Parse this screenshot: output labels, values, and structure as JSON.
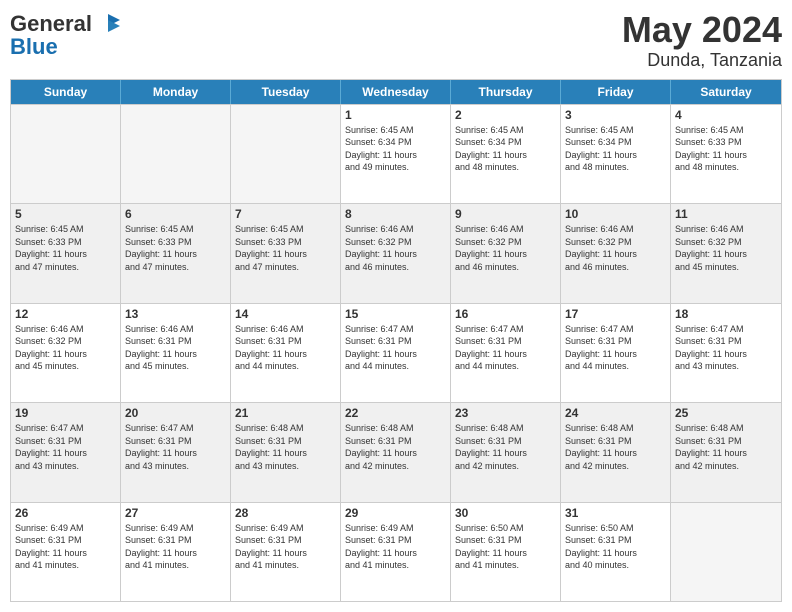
{
  "header": {
    "logo_general": "General",
    "logo_blue": "Blue",
    "month": "May 2024",
    "location": "Dunda, Tanzania"
  },
  "calendar": {
    "days": [
      "Sunday",
      "Monday",
      "Tuesday",
      "Wednesday",
      "Thursday",
      "Friday",
      "Saturday"
    ],
    "rows": [
      [
        {
          "day": "",
          "info": "",
          "empty": true
        },
        {
          "day": "",
          "info": "",
          "empty": true
        },
        {
          "day": "",
          "info": "",
          "empty": true
        },
        {
          "day": "1",
          "info": "Sunrise: 6:45 AM\nSunset: 6:34 PM\nDaylight: 11 hours\nand 49 minutes.",
          "empty": false
        },
        {
          "day": "2",
          "info": "Sunrise: 6:45 AM\nSunset: 6:34 PM\nDaylight: 11 hours\nand 48 minutes.",
          "empty": false
        },
        {
          "day": "3",
          "info": "Sunrise: 6:45 AM\nSunset: 6:34 PM\nDaylight: 11 hours\nand 48 minutes.",
          "empty": false
        },
        {
          "day": "4",
          "info": "Sunrise: 6:45 AM\nSunset: 6:33 PM\nDaylight: 11 hours\nand 48 minutes.",
          "empty": false
        }
      ],
      [
        {
          "day": "5",
          "info": "Sunrise: 6:45 AM\nSunset: 6:33 PM\nDaylight: 11 hours\nand 47 minutes.",
          "empty": false,
          "shaded": true
        },
        {
          "day": "6",
          "info": "Sunrise: 6:45 AM\nSunset: 6:33 PM\nDaylight: 11 hours\nand 47 minutes.",
          "empty": false,
          "shaded": true
        },
        {
          "day": "7",
          "info": "Sunrise: 6:45 AM\nSunset: 6:33 PM\nDaylight: 11 hours\nand 47 minutes.",
          "empty": false,
          "shaded": true
        },
        {
          "day": "8",
          "info": "Sunrise: 6:46 AM\nSunset: 6:32 PM\nDaylight: 11 hours\nand 46 minutes.",
          "empty": false,
          "shaded": true
        },
        {
          "day": "9",
          "info": "Sunrise: 6:46 AM\nSunset: 6:32 PM\nDaylight: 11 hours\nand 46 minutes.",
          "empty": false,
          "shaded": true
        },
        {
          "day": "10",
          "info": "Sunrise: 6:46 AM\nSunset: 6:32 PM\nDaylight: 11 hours\nand 46 minutes.",
          "empty": false,
          "shaded": true
        },
        {
          "day": "11",
          "info": "Sunrise: 6:46 AM\nSunset: 6:32 PM\nDaylight: 11 hours\nand 45 minutes.",
          "empty": false,
          "shaded": true
        }
      ],
      [
        {
          "day": "12",
          "info": "Sunrise: 6:46 AM\nSunset: 6:32 PM\nDaylight: 11 hours\nand 45 minutes.",
          "empty": false
        },
        {
          "day": "13",
          "info": "Sunrise: 6:46 AM\nSunset: 6:31 PM\nDaylight: 11 hours\nand 45 minutes.",
          "empty": false
        },
        {
          "day": "14",
          "info": "Sunrise: 6:46 AM\nSunset: 6:31 PM\nDaylight: 11 hours\nand 44 minutes.",
          "empty": false
        },
        {
          "day": "15",
          "info": "Sunrise: 6:47 AM\nSunset: 6:31 PM\nDaylight: 11 hours\nand 44 minutes.",
          "empty": false
        },
        {
          "day": "16",
          "info": "Sunrise: 6:47 AM\nSunset: 6:31 PM\nDaylight: 11 hours\nand 44 minutes.",
          "empty": false
        },
        {
          "day": "17",
          "info": "Sunrise: 6:47 AM\nSunset: 6:31 PM\nDaylight: 11 hours\nand 44 minutes.",
          "empty": false
        },
        {
          "day": "18",
          "info": "Sunrise: 6:47 AM\nSunset: 6:31 PM\nDaylight: 11 hours\nand 43 minutes.",
          "empty": false
        }
      ],
      [
        {
          "day": "19",
          "info": "Sunrise: 6:47 AM\nSunset: 6:31 PM\nDaylight: 11 hours\nand 43 minutes.",
          "empty": false,
          "shaded": true
        },
        {
          "day": "20",
          "info": "Sunrise: 6:47 AM\nSunset: 6:31 PM\nDaylight: 11 hours\nand 43 minutes.",
          "empty": false,
          "shaded": true
        },
        {
          "day": "21",
          "info": "Sunrise: 6:48 AM\nSunset: 6:31 PM\nDaylight: 11 hours\nand 43 minutes.",
          "empty": false,
          "shaded": true
        },
        {
          "day": "22",
          "info": "Sunrise: 6:48 AM\nSunset: 6:31 PM\nDaylight: 11 hours\nand 42 minutes.",
          "empty": false,
          "shaded": true
        },
        {
          "day": "23",
          "info": "Sunrise: 6:48 AM\nSunset: 6:31 PM\nDaylight: 11 hours\nand 42 minutes.",
          "empty": false,
          "shaded": true
        },
        {
          "day": "24",
          "info": "Sunrise: 6:48 AM\nSunset: 6:31 PM\nDaylight: 11 hours\nand 42 minutes.",
          "empty": false,
          "shaded": true
        },
        {
          "day": "25",
          "info": "Sunrise: 6:48 AM\nSunset: 6:31 PM\nDaylight: 11 hours\nand 42 minutes.",
          "empty": false,
          "shaded": true
        }
      ],
      [
        {
          "day": "26",
          "info": "Sunrise: 6:49 AM\nSunset: 6:31 PM\nDaylight: 11 hours\nand 41 minutes.",
          "empty": false
        },
        {
          "day": "27",
          "info": "Sunrise: 6:49 AM\nSunset: 6:31 PM\nDaylight: 11 hours\nand 41 minutes.",
          "empty": false
        },
        {
          "day": "28",
          "info": "Sunrise: 6:49 AM\nSunset: 6:31 PM\nDaylight: 11 hours\nand 41 minutes.",
          "empty": false
        },
        {
          "day": "29",
          "info": "Sunrise: 6:49 AM\nSunset: 6:31 PM\nDaylight: 11 hours\nand 41 minutes.",
          "empty": false
        },
        {
          "day": "30",
          "info": "Sunrise: 6:50 AM\nSunset: 6:31 PM\nDaylight: 11 hours\nand 41 minutes.",
          "empty": false
        },
        {
          "day": "31",
          "info": "Sunrise: 6:50 AM\nSunset: 6:31 PM\nDaylight: 11 hours\nand 40 minutes.",
          "empty": false
        },
        {
          "day": "",
          "info": "",
          "empty": true
        }
      ]
    ]
  }
}
